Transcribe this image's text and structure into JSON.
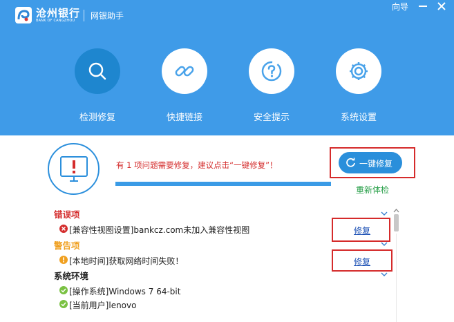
{
  "header": {
    "bank_name": "沧州银行",
    "bank_name_en": "BANK OF CANGZHOU",
    "app_title": "网银助手",
    "guide_label": "向导"
  },
  "nav": {
    "items": [
      {
        "label": "检测修复",
        "icon": "search-icon",
        "active": true
      },
      {
        "label": "快捷链接",
        "icon": "link-icon",
        "active": false
      },
      {
        "label": "安全提示",
        "icon": "question-icon",
        "active": false
      },
      {
        "label": "系统设置",
        "icon": "gear-icon",
        "active": false
      }
    ]
  },
  "main": {
    "status_text": "有 1 项问题需要修复，建议点击“一键修复”！",
    "one_key_fix_label": "一键修复",
    "recheck_label": "重新体检"
  },
  "sections": {
    "error": {
      "title": "错误项",
      "items": [
        {
          "text": "[兼容性视图设置]bankcz.com未加入兼容性视图",
          "action": "修复"
        }
      ]
    },
    "warning": {
      "title": "警告项",
      "items": [
        {
          "text": "[本地时间]获取网络时间失败！",
          "action": "修复"
        }
      ]
    },
    "system": {
      "title": "系统环境",
      "items": [
        {
          "text": "[操作系统]Windows 7 64-bit"
        },
        {
          "text": "[当前用户]lenovo"
        }
      ]
    }
  },
  "colors": {
    "header_bg": "#3f9be8",
    "accent_blue": "#2a8fdb",
    "error_red": "#d42d2d",
    "warning_orange": "#f0a020",
    "ok_green": "#7ac143",
    "link_blue": "#1a4fb4"
  }
}
